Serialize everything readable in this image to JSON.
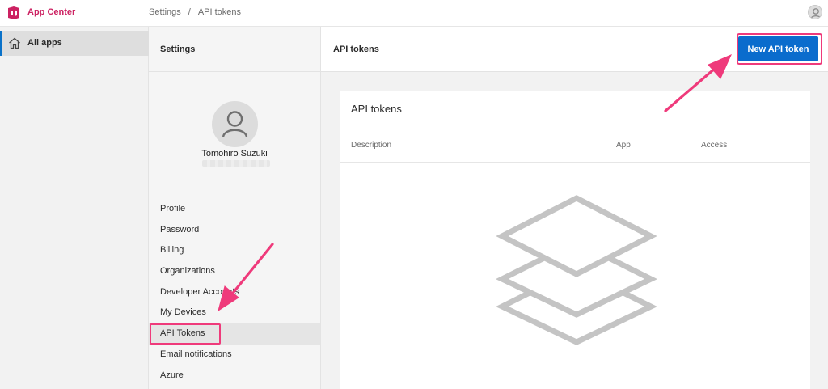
{
  "app": {
    "brand": "App Center",
    "brand_color": "#cc2262",
    "accent_color": "#0a6ccd",
    "annotation_color": "#ef3a7b"
  },
  "breadcrumb": {
    "items": [
      "Settings",
      "API tokens"
    ],
    "separator": "/"
  },
  "icons": {
    "logo": "app-center-logo-icon",
    "account": "user-avatar-icon",
    "home": "home-icon",
    "empty_state": "layers-stack-icon"
  },
  "leftnav": {
    "all_apps_label": "All apps"
  },
  "settings": {
    "title": "Settings",
    "profile_name": "Tomohiro Suzuki",
    "menu": [
      {
        "label": "Profile"
      },
      {
        "label": "Password"
      },
      {
        "label": "Billing"
      },
      {
        "label": "Organizations"
      },
      {
        "label": "Developer Accounts"
      },
      {
        "label": "My Devices"
      },
      {
        "label": "API Tokens",
        "active": true
      },
      {
        "label": "Email notifications"
      },
      {
        "label": "Azure"
      }
    ]
  },
  "main": {
    "header_title": "API tokens",
    "new_button_label": "New API token",
    "card_title": "API tokens",
    "columns": [
      "Description",
      "App",
      "Access"
    ]
  }
}
